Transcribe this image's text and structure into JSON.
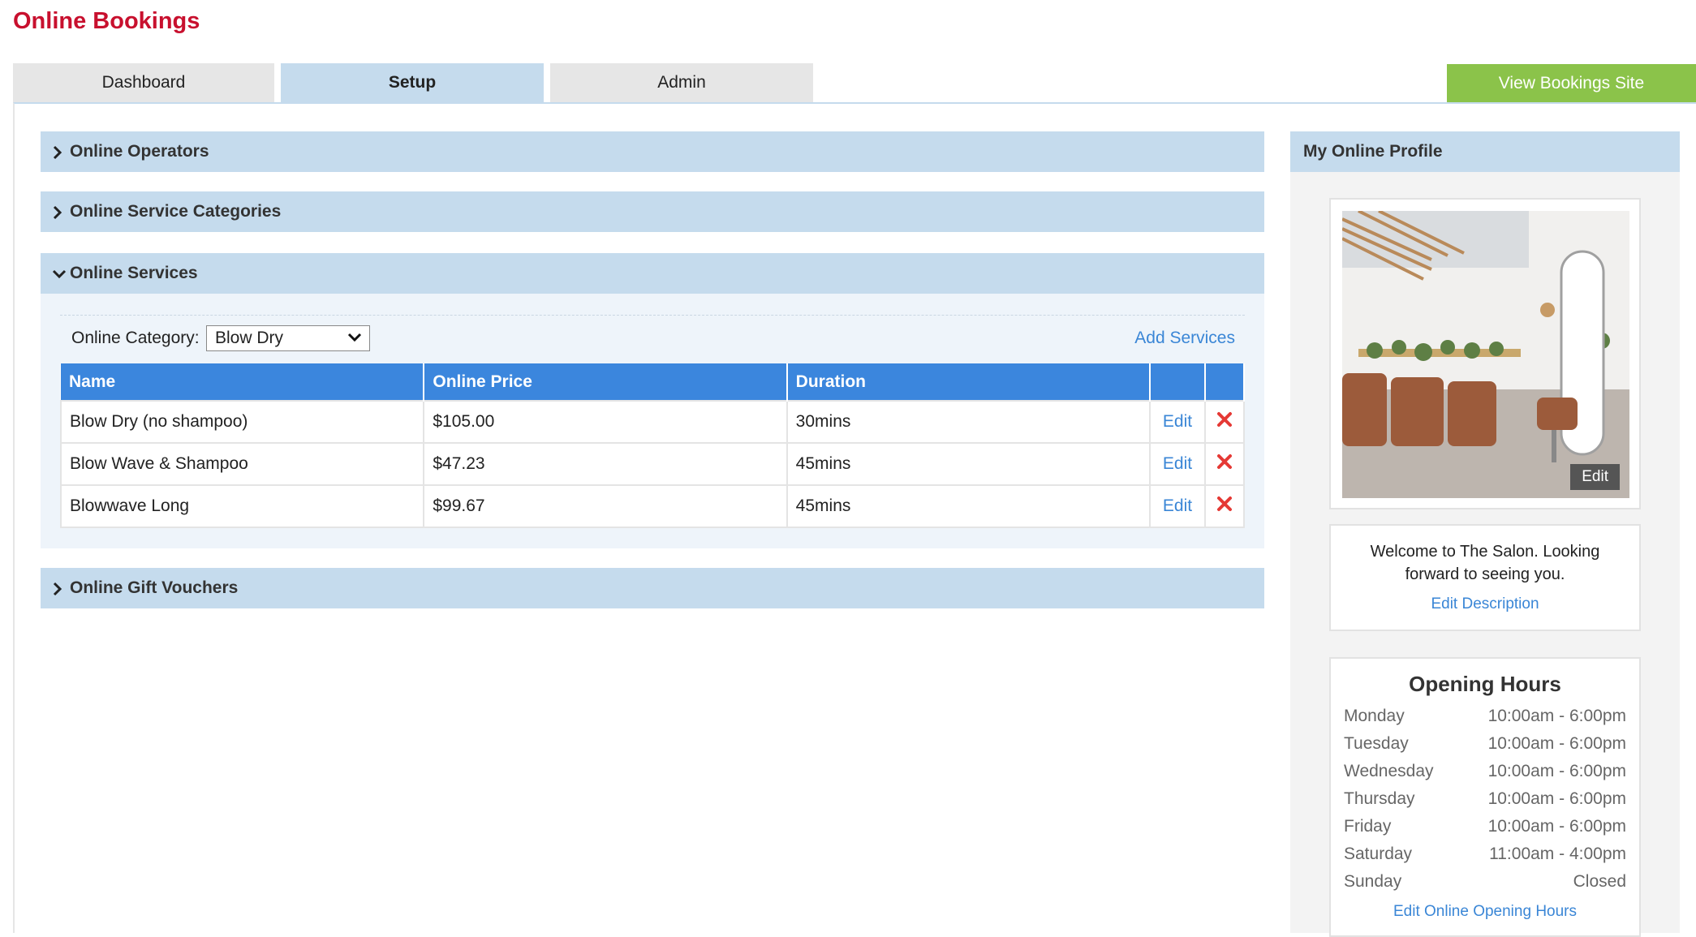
{
  "page": {
    "title": "Online Bookings"
  },
  "tabs": [
    {
      "label": "Dashboard",
      "active": false
    },
    {
      "label": "Setup",
      "active": true
    },
    {
      "label": "Admin",
      "active": false
    }
  ],
  "view_site_label": "View Bookings Site",
  "colors": {
    "accent": "#3b86dd",
    "title": "#c8102e",
    "panel": "#c5dbed",
    "green_button": "#8bc34a",
    "delete": "#e53935"
  },
  "panels": {
    "operators": "Online Operators",
    "categories": "Online Service Categories",
    "services": "Online Services",
    "vouchers": "Online Gift Vouchers"
  },
  "services": {
    "category_label": "Online Category:",
    "category_selected": "Blow Dry",
    "add_label": "Add Services",
    "columns": [
      "Name",
      "Online Price",
      "Duration"
    ],
    "edit_label": "Edit",
    "rows": [
      {
        "name": "Blow Dry (no shampoo)",
        "price": "$105.00",
        "duration": "30mins"
      },
      {
        "name": "Blow Wave & Shampoo",
        "price": "$47.23",
        "duration": "45mins"
      },
      {
        "name": "Blowwave Long",
        "price": "$99.67",
        "duration": "45mins"
      }
    ]
  },
  "profile": {
    "header": "My Online Profile",
    "photo_edit": "Edit",
    "description": "Welcome to The Salon. Looking forward to seeing you.",
    "edit_description": "Edit Description",
    "hours_title": "Opening Hours",
    "hours": [
      {
        "day": "Monday",
        "time": "10:00am - 6:00pm"
      },
      {
        "day": "Tuesday",
        "time": "10:00am - 6:00pm"
      },
      {
        "day": "Wednesday",
        "time": "10:00am - 6:00pm"
      },
      {
        "day": "Thursday",
        "time": "10:00am - 6:00pm"
      },
      {
        "day": "Friday",
        "time": "10:00am - 6:00pm"
      },
      {
        "day": "Saturday",
        "time": "11:00am - 4:00pm"
      },
      {
        "day": "Sunday",
        "time": "Closed"
      }
    ],
    "edit_hours": "Edit Online Opening Hours"
  }
}
